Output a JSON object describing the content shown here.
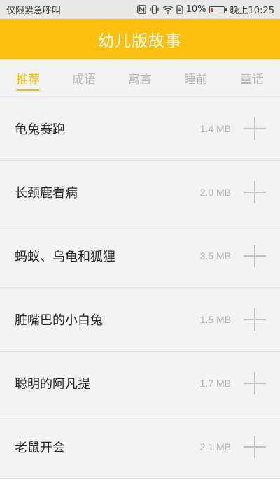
{
  "status": {
    "carrier": "仅限紧急呼叫",
    "battery": "10%",
    "time": "晚上10:25",
    "icons": [
      "nfc-icon",
      "vibrate-icon",
      "wifi-icon",
      "sim-icon",
      "battery-icon"
    ]
  },
  "header": {
    "title": "幼儿版故事"
  },
  "tabs": [
    {
      "label": "推荐",
      "active": true
    },
    {
      "label": "成语",
      "active": false
    },
    {
      "label": "寓言",
      "active": false
    },
    {
      "label": "睡前",
      "active": false
    },
    {
      "label": "童话",
      "active": false
    }
  ],
  "stories": [
    {
      "title": "龟兔赛跑",
      "size": "1.4 MB"
    },
    {
      "title": "长颈鹿看病",
      "size": "2.0 MB"
    },
    {
      "title": "蚂蚁、乌龟和狐狸",
      "size": "3.5 MB"
    },
    {
      "title": "脏嘴巴的小白兔",
      "size": "1.5 MB"
    },
    {
      "title": "聪明的阿凡提",
      "size": "1.7 MB"
    },
    {
      "title": "老鼠开会",
      "size": "2.1 MB"
    }
  ],
  "colors": {
    "accent": "#fbbf0f",
    "active_tab": "#f6b800"
  }
}
